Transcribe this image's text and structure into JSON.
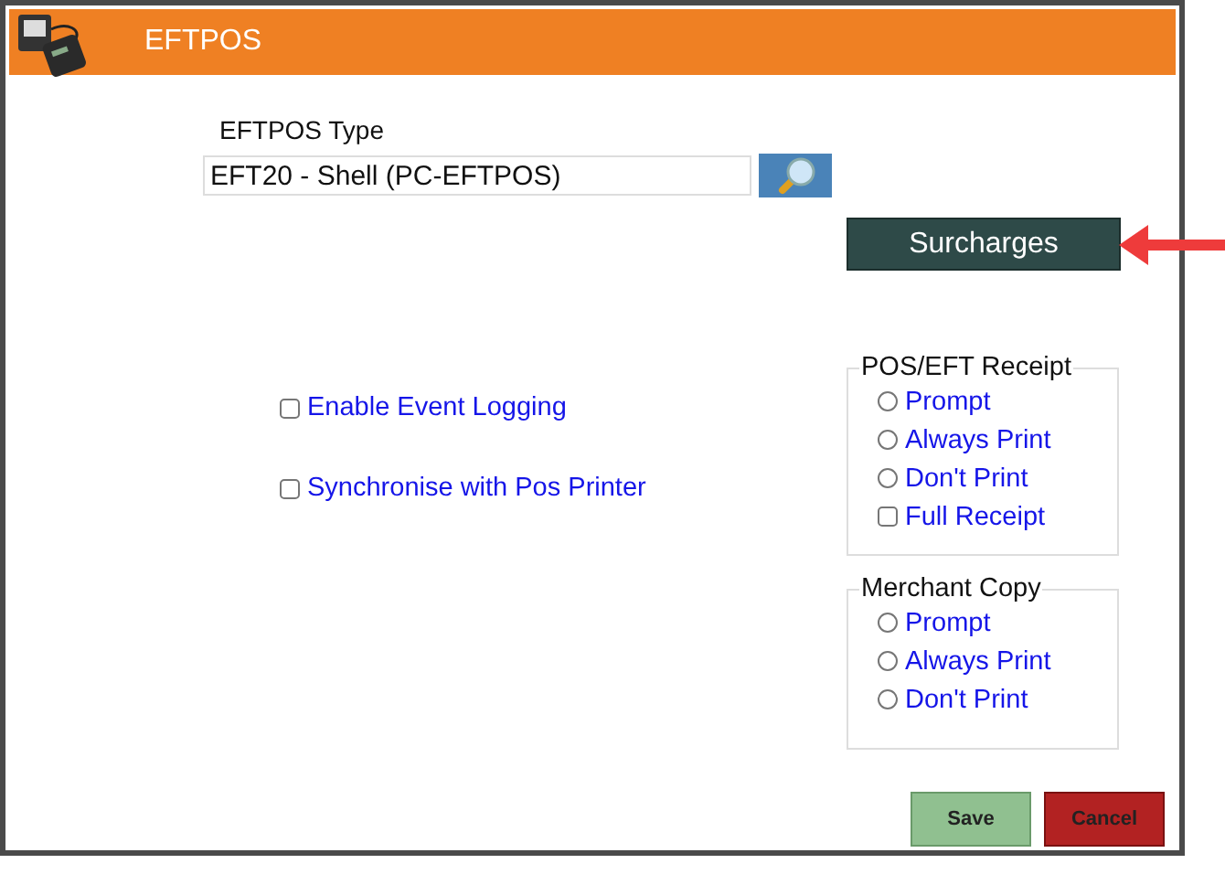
{
  "window": {
    "title": "EFTPOS"
  },
  "eftpos_type": {
    "label": "EFTPOS Type",
    "value": "EFT20 - Shell (PC-EFTPOS)"
  },
  "surcharges_button": "Surcharges",
  "options": [
    {
      "label": "Enable Event Logging",
      "checked": false
    },
    {
      "label": "Synchronise with Pos Printer",
      "checked": false
    }
  ],
  "groups": [
    {
      "title": "POS/EFT Receipt",
      "items": [
        {
          "kind": "radio",
          "label": "Prompt",
          "selected": false
        },
        {
          "kind": "radio",
          "label": "Always Print",
          "selected": false
        },
        {
          "kind": "radio",
          "label": "Don't Print",
          "selected": false
        },
        {
          "kind": "checkbox",
          "label": "Full Receipt",
          "checked": false
        }
      ]
    },
    {
      "title": "Merchant Copy",
      "items": [
        {
          "kind": "radio",
          "label": "Prompt",
          "selected": false
        },
        {
          "kind": "radio",
          "label": "Always Print",
          "selected": false
        },
        {
          "kind": "radio",
          "label": "Don't Print",
          "selected": false
        }
      ]
    }
  ],
  "buttons": [
    {
      "kind": "save",
      "label": "Save"
    },
    {
      "kind": "cancel",
      "label": "Cancel"
    }
  ]
}
